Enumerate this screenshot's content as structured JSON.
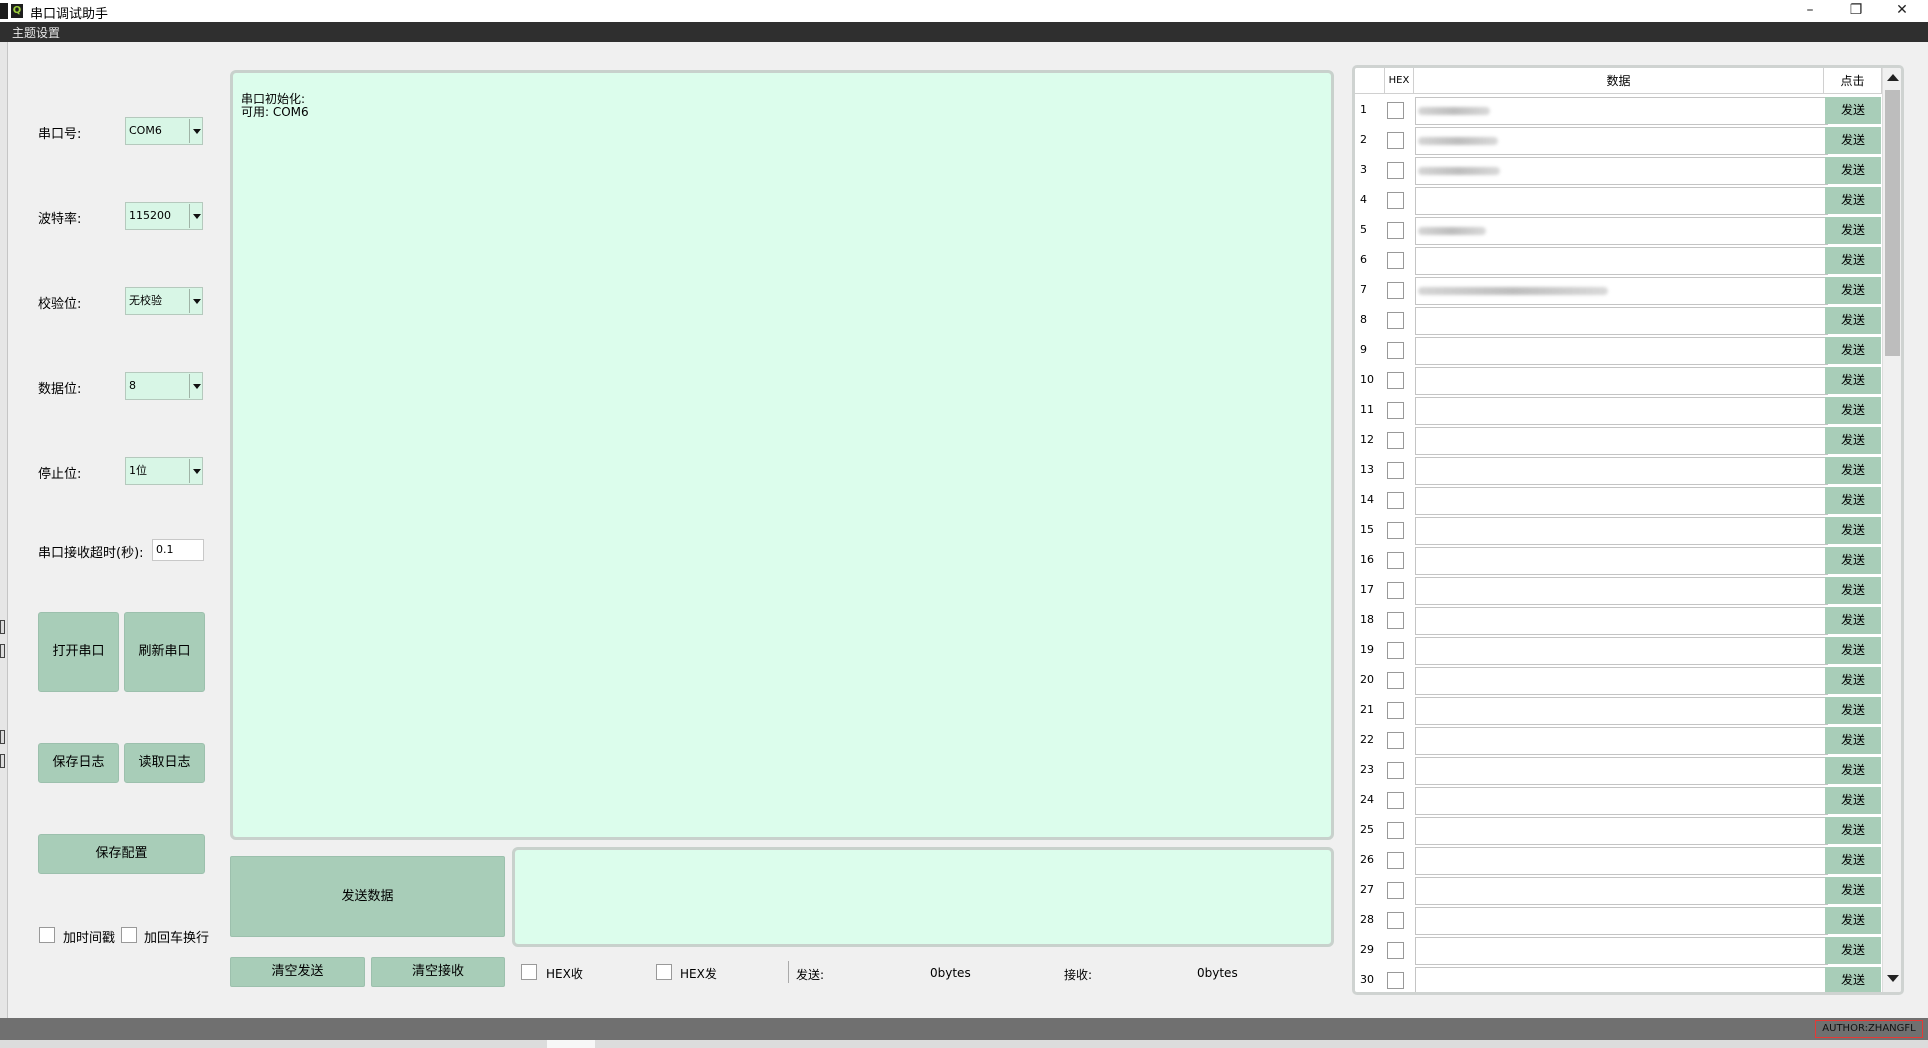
{
  "window": {
    "title": "串口调试助手",
    "minimize_icon": "minimize-icon",
    "restore_icon": "restore-icon",
    "close_icon": "close-icon"
  },
  "menu": {
    "theme": "主题设置"
  },
  "settings": {
    "port_label": "串口号:",
    "port_value": "COM6",
    "baud_label": "波特率:",
    "baud_value": "115200",
    "parity_label": "校验位:",
    "parity_value": "无校验",
    "databits_label": "数据位:",
    "databits_value": "8",
    "stopbits_label": "停止位:",
    "stopbits_value": "1位",
    "timeout_label": "串口接收超时(秒):",
    "timeout_value": "0.1"
  },
  "buttons": {
    "open_port": "打开串口",
    "refresh_port": "刷新串口",
    "save_log": "保存日志",
    "read_log": "读取日志",
    "save_config": "保存配置",
    "send_data": "发送数据",
    "clear_send": "清空发送",
    "clear_recv": "清空接收"
  },
  "options": {
    "add_time": "加时间戳",
    "add_newline": "加回车换行",
    "hex_recv": "HEX收",
    "hex_send": "HEX发"
  },
  "receive": {
    "text": "串口初始化:\n可用: COM6"
  },
  "stats": {
    "send_label": "发送:",
    "send_value": "0bytes",
    "recv_label": "接收:",
    "recv_value": "0bytes"
  },
  "table": {
    "headers": {
      "hex": "HEX",
      "data": "数据",
      "action": "点击"
    },
    "button_label": "发送",
    "rows": [
      "1",
      "2",
      "3",
      "4",
      "5",
      "6",
      "7",
      "8",
      "9",
      "10",
      "11",
      "12",
      "13",
      "14",
      "15",
      "16",
      "17",
      "18",
      "19",
      "20",
      "21",
      "22",
      "23",
      "24",
      "25",
      "26",
      "27",
      "28",
      "29",
      "30"
    ]
  },
  "status": {
    "author": "AUTHOR:ZHANGFL"
  },
  "colors": {
    "accent": "#a8cdb8",
    "panel_bg": "#dcfdec",
    "menubar": "#2f2f2f",
    "statusbar": "#707070",
    "author_border": "#e53935"
  }
}
